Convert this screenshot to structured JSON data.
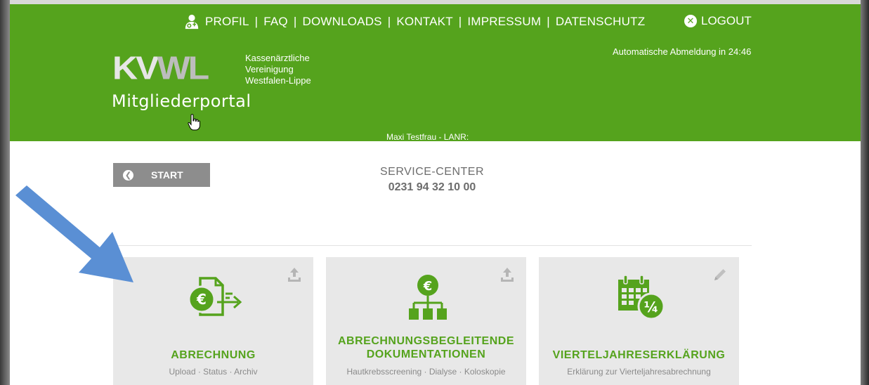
{
  "nav": {
    "items": [
      "PROFIL",
      "FAQ",
      "DOWNLOADS",
      "KONTAKT",
      "IMPRESSUM",
      "DATENSCHUTZ"
    ],
    "logout": "LOGOUT"
  },
  "logo": {
    "kv": "KV",
    "wl": "WL",
    "line1": "Kassenärztliche",
    "line2": "Vereinigung",
    "line3": "Westfalen-Lippe"
  },
  "portal_title": "Mitgliederportal",
  "auto_logout": "Automatische Abmeldung in 24:46",
  "user_line": "Maxi Testfrau - LANR:",
  "start_label": "START",
  "service": {
    "label": "SERVICE-CENTER",
    "phone": "0231 94 32 10 00"
  },
  "tiles": [
    {
      "title": "ABRECHNUNG",
      "subtitle": "Upload · Status · Archiv",
      "action_icon": "upload-icon",
      "icon": "invoice-euro-icon"
    },
    {
      "title_line1": "ABRECHNUNGSBEGLEITENDE",
      "title_line2": "DOKUMENTATIONEN",
      "subtitle": "Hautkrebsscreening · Dialyse · Koloskopie",
      "action_icon": "upload-icon",
      "icon": "euro-hierarchy-icon"
    },
    {
      "title": "VIERTELJAHRESERKLÄRUNG",
      "subtitle": "Erklärung zur Vierteljahresabrechnung",
      "action_icon": "pencil-icon",
      "icon": "calendar-quarter-icon",
      "badge": "¼"
    }
  ],
  "colors": {
    "brand_green": "#55a31d",
    "tile_bg": "#e8e8e8",
    "start_gray": "#8d8d8d",
    "arrow_blue": "#5a8fd4"
  }
}
